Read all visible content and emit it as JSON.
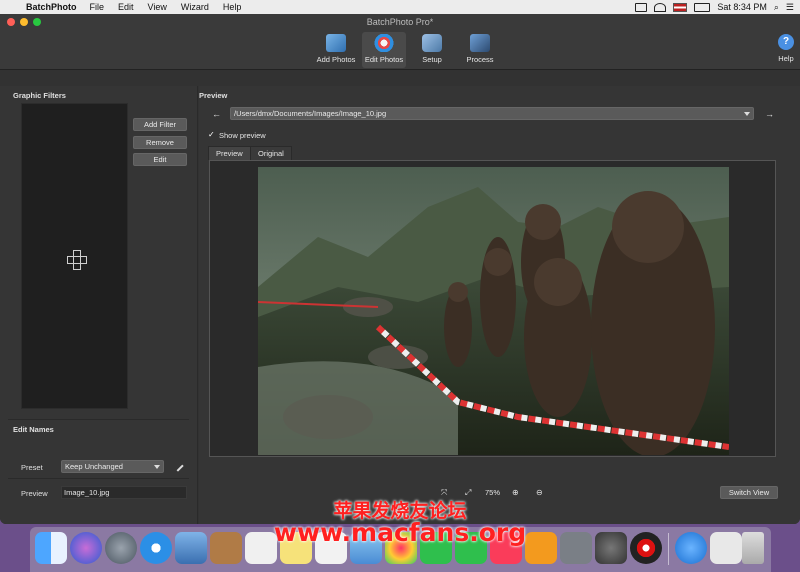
{
  "menubar": {
    "app_name": "BatchPhoto",
    "items": [
      "File",
      "Edit",
      "View",
      "Wizard",
      "Help"
    ],
    "clock": "Sat 8:34 PM"
  },
  "window": {
    "title": "BatchPhoto Pro*"
  },
  "toolbar": {
    "buttons": [
      {
        "label": "Add Photos",
        "icon": "add-photos-icon"
      },
      {
        "label": "Edit Photos",
        "icon": "edit-photos-icon"
      },
      {
        "label": "Setup",
        "icon": "setup-icon"
      },
      {
        "label": "Process",
        "icon": "process-icon"
      }
    ],
    "help_label": "Help"
  },
  "left": {
    "graphic_filters_title": "Graphic Filters",
    "add_filter": "Add Filter",
    "remove": "Remove",
    "edit": "Edit",
    "edit_names_title": "Edit Names",
    "preset_label": "Preset",
    "preset_value": "Keep Unchanged",
    "preview_label": "Preview",
    "preview_value": "Image_10.jpg"
  },
  "preview": {
    "title": "Preview",
    "path": "/Users/dmx/Documents/Images/Image_10.jpg",
    "show_preview_label": "Show preview",
    "show_preview_checked": "✓",
    "tabs": [
      "Preview",
      "Original"
    ],
    "zoom": "75%",
    "switch_view": "Switch View"
  },
  "watermark": {
    "line1": "苹果发烧友论坛",
    "line2": "www.macfans.org"
  }
}
